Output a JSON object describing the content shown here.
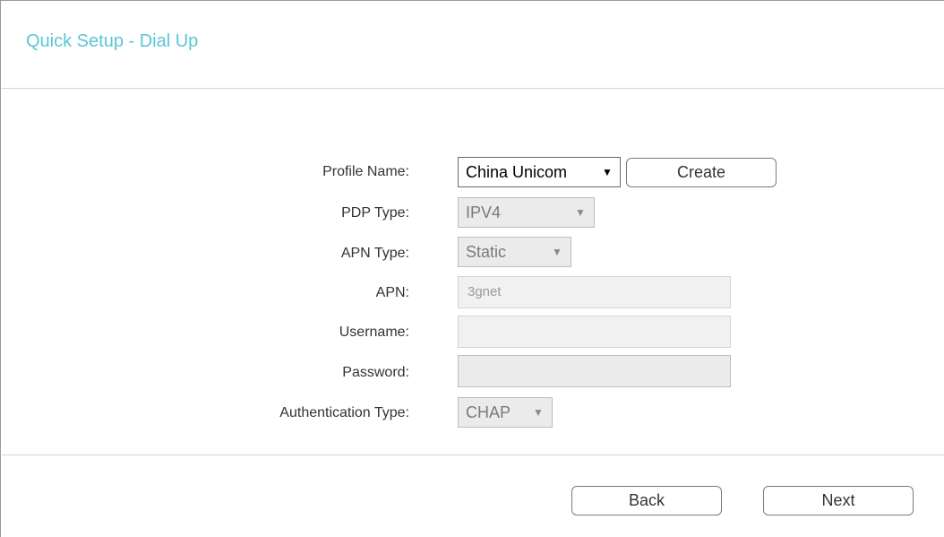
{
  "page": {
    "title": "Quick Setup - Dial Up"
  },
  "form": {
    "profile_name": {
      "label": "Profile Name:",
      "value": "China Unicom",
      "create_label": "Create"
    },
    "pdp_type": {
      "label": "PDP Type:",
      "value": "IPV4"
    },
    "apn_type": {
      "label": "APN Type:",
      "value": "Static"
    },
    "apn": {
      "label": "APN:",
      "value": "3gnet"
    },
    "username": {
      "label": "Username:",
      "value": ""
    },
    "password": {
      "label": "Password:",
      "value": ""
    },
    "auth_type": {
      "label": "Authentication Type:",
      "value": "CHAP"
    }
  },
  "footer": {
    "back_label": "Back",
    "next_label": "Next"
  },
  "icons": {
    "dropdown_arrow": "▼"
  },
  "colors": {
    "title": "#5bc6d6",
    "divider": "#d5d5d5",
    "disabled_field": "#ebebeb"
  }
}
